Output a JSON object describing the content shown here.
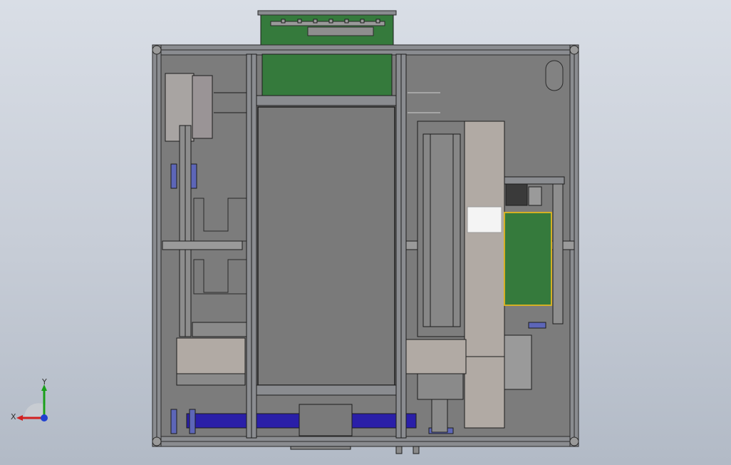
{
  "viewport": {
    "background_top": "#d9dee6",
    "background_bottom": "#b2bac6"
  },
  "model": {
    "view": "top",
    "colors": {
      "frame": "#8a8c90",
      "frame_dark": "#3a3a3a",
      "panel": "#7c7c7c",
      "pcb_green": "#357a3c",
      "tan_block": "#b1aaa4",
      "belt_blue": "#2a1fa8",
      "bracket_blue": "#5d66b8",
      "highlight": "#f4f4f4"
    }
  },
  "triad": {
    "x_label": "X",
    "y_label": "Y",
    "x_color": "#d22020",
    "y_color": "#1aa01a",
    "z_color": "#2040d0"
  }
}
